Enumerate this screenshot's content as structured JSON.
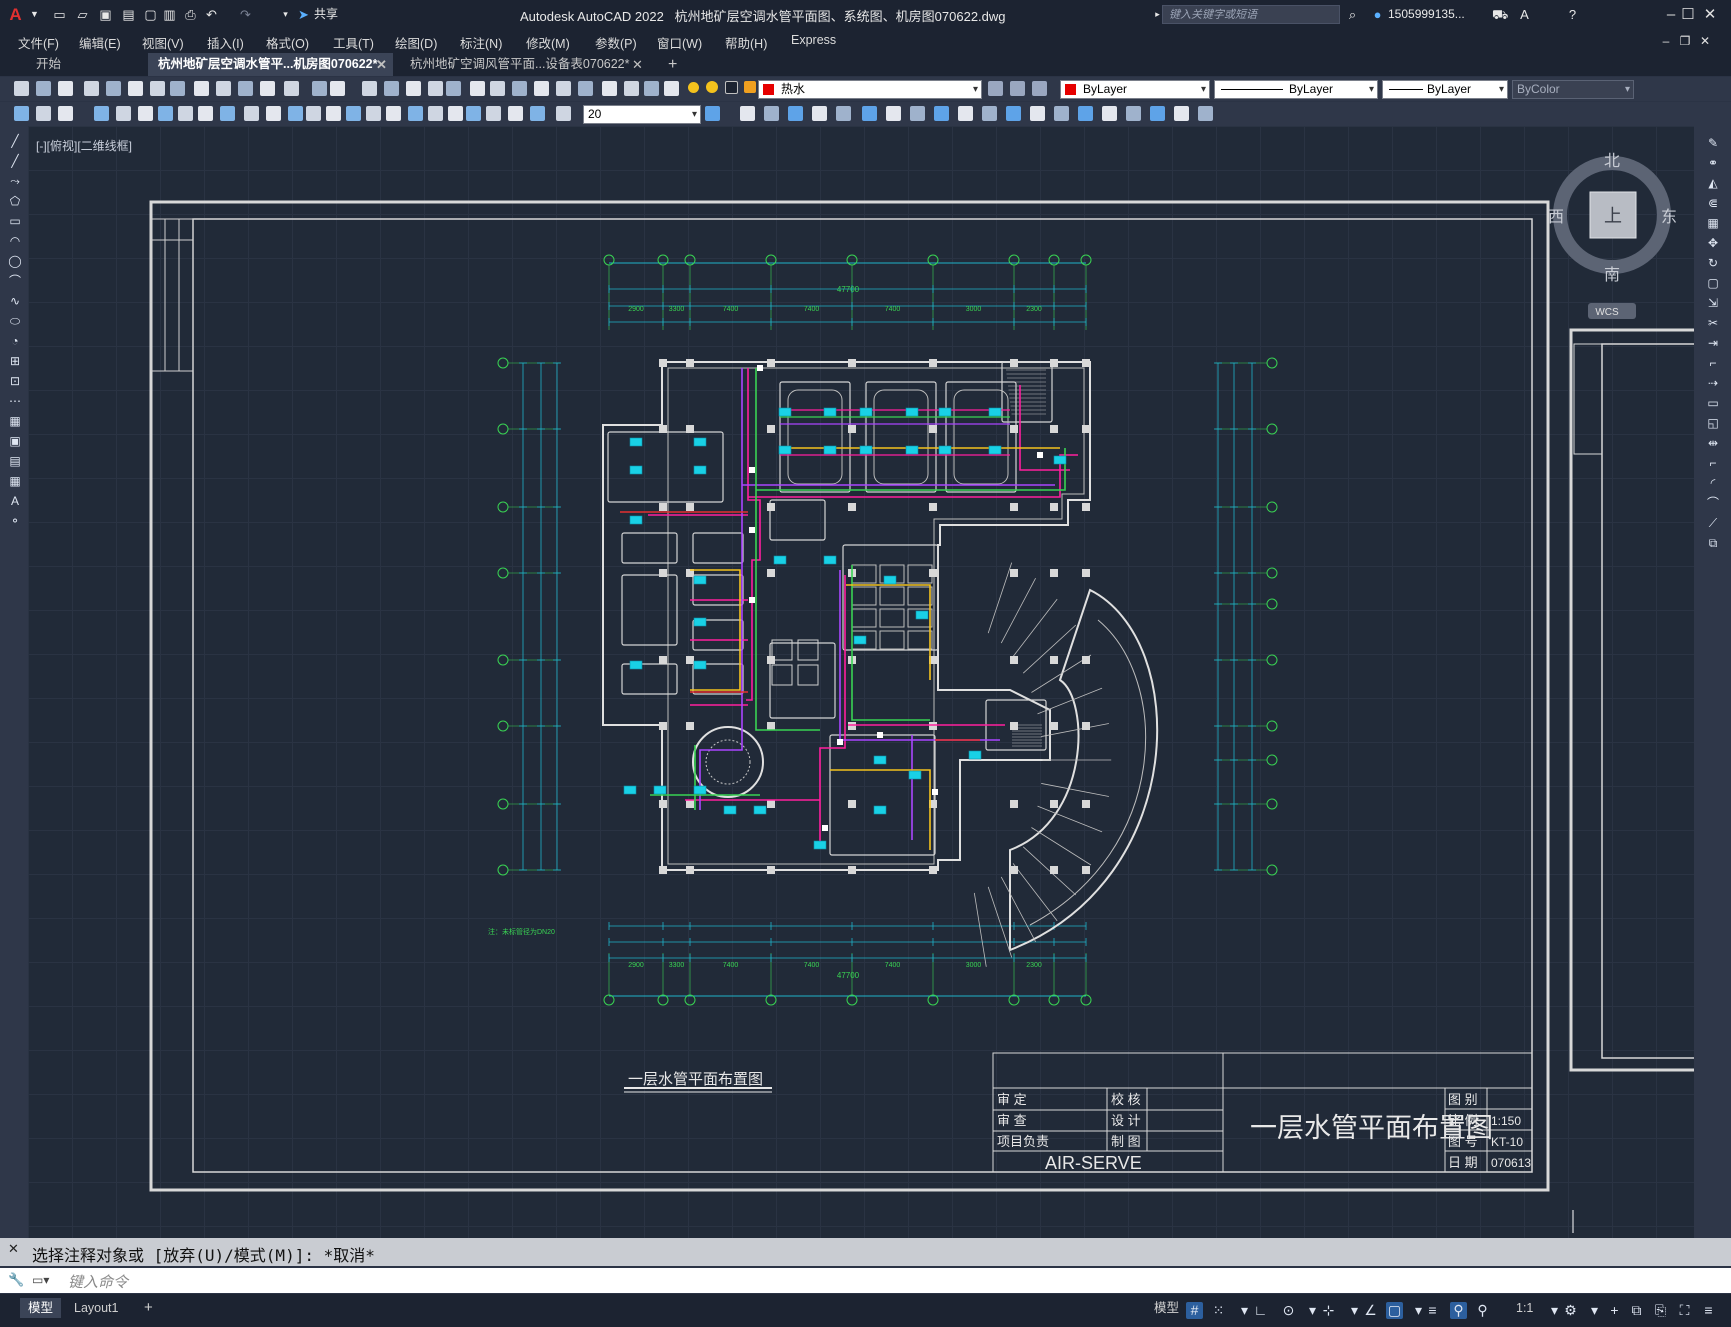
{
  "app": {
    "logo": "A",
    "title": "Autodesk AutoCAD 2022",
    "document": "杭州地矿层空调水管平面图、系统图、机房图070622.dwg",
    "share_label": "共享",
    "search_placeholder": "键入关键字或短语",
    "user": "1505999135...",
    "window_controls": [
      "minimize-icon",
      "restore-icon",
      "close-icon"
    ]
  },
  "menu": [
    "文件(F)",
    "编辑(E)",
    "视图(V)",
    "插入(I)",
    "格式(O)",
    "工具(T)",
    "绘图(D)",
    "标注(N)",
    "修改(M)",
    "参数(P)",
    "窗口(W)",
    "帮助(H)",
    "Express"
  ],
  "tabs": [
    {
      "label": "开始",
      "active": false
    },
    {
      "label": "杭州地矿层空调水管平...机房图070622*",
      "active": true
    },
    {
      "label": "杭州地矿空调风管平面...设备表070622*",
      "active": false
    }
  ],
  "layers": {
    "current_layer": "热水",
    "color": "ByLayer",
    "linetype": "ByLayer",
    "lineweight": "ByLayer",
    "plotstyle": "ByColor",
    "dimstyle_value": "20"
  },
  "view": {
    "label": "[-][俯视][二维线框]",
    "compass": {
      "north": "北",
      "south": "南",
      "east": "东",
      "west": "西",
      "top": "上",
      "ucs": "WCS"
    }
  },
  "drawing": {
    "title_under": "一层水管平面布置图",
    "note": "注：未标管径为DN20",
    "overall_dim": "47700",
    "dims_top": [
      "2900",
      "3300",
      "7400",
      "7400",
      "7400",
      "3000",
      "2300"
    ],
    "title_block": {
      "rows_left": [
        "审 定",
        "审 查",
        "项目负责"
      ],
      "rows_mid": [
        "校 核",
        "设 计",
        "制 图"
      ],
      "company": "AIR-SERVE",
      "big_title": "一层水管平面布置图",
      "field_labels": [
        "图 别",
        "比 例",
        "图 号",
        "日 期"
      ],
      "field_values": [
        "",
        "1:150",
        "KT-10",
        "070613"
      ]
    }
  },
  "command": {
    "history": "选择注释对象或 [放弃(U)/模式(M)]: *取消*",
    "placeholder": "键入命令"
  },
  "status": {
    "layout_tabs": [
      "模型",
      "Layout1"
    ],
    "model_button": "模型",
    "scale": "1:1"
  }
}
